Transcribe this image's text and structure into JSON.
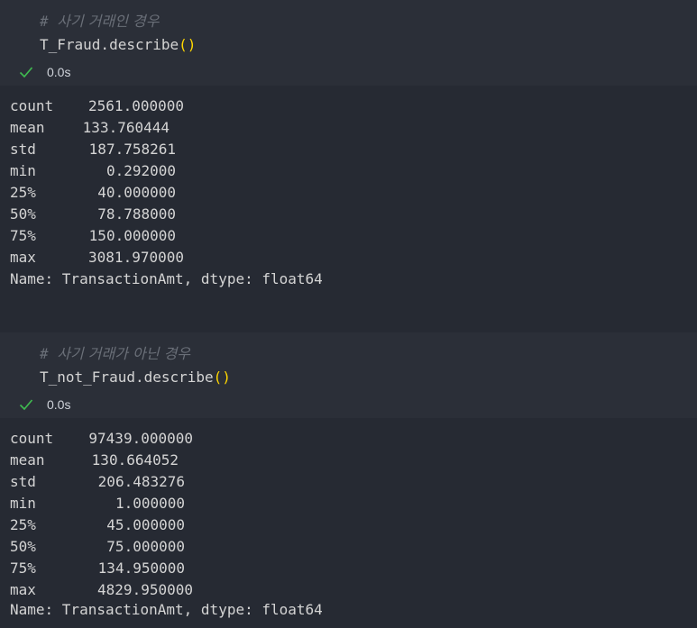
{
  "cells": [
    {
      "comment_prefix": "# ",
      "comment_text": "사기 거래인 경우",
      "code_prefix": "T_Fraud.describe",
      "code_parens": "()",
      "exec_time": "0.0s",
      "output": {
        "rows": [
          {
            "name": "count",
            "value": "2561.000000"
          },
          {
            "name": "mean",
            "value": "133.760444"
          },
          {
            "name": "std",
            "value": "187.758261"
          },
          {
            "name": "min",
            "value": "0.292000"
          },
          {
            "name": "25%",
            "value": "40.000000"
          },
          {
            "name": "50%",
            "value": "78.788000"
          },
          {
            "name": "75%",
            "value": "150.000000"
          },
          {
            "name": "max",
            "value": "3081.970000"
          }
        ],
        "footer": "Name: TransactionAmt, dtype: float64"
      }
    },
    {
      "comment_prefix": "# ",
      "comment_text": "사기 거래가 아닌 경우",
      "code_prefix": "T_not_Fraud.describe",
      "code_parens": "()",
      "exec_time": "0.0s",
      "output": {
        "rows": [
          {
            "name": "count",
            "value": "97439.000000"
          },
          {
            "name": "mean",
            "value": "130.664052"
          },
          {
            "name": "std",
            "value": "206.483276"
          },
          {
            "name": "min",
            "value": "1.000000"
          },
          {
            "name": "25%",
            "value": "45.000000"
          },
          {
            "name": "50%",
            "value": "75.000000"
          },
          {
            "name": "75%",
            "value": "134.950000"
          },
          {
            "name": "max",
            "value": "4829.950000"
          }
        ],
        "footer": "Name: TransactionAmt, dtype: float64"
      }
    }
  ],
  "colors": {
    "check": "#3fb950",
    "paren": "#ffd700",
    "comment": "#6a6f78"
  },
  "icons": {
    "status": "check-icon"
  }
}
